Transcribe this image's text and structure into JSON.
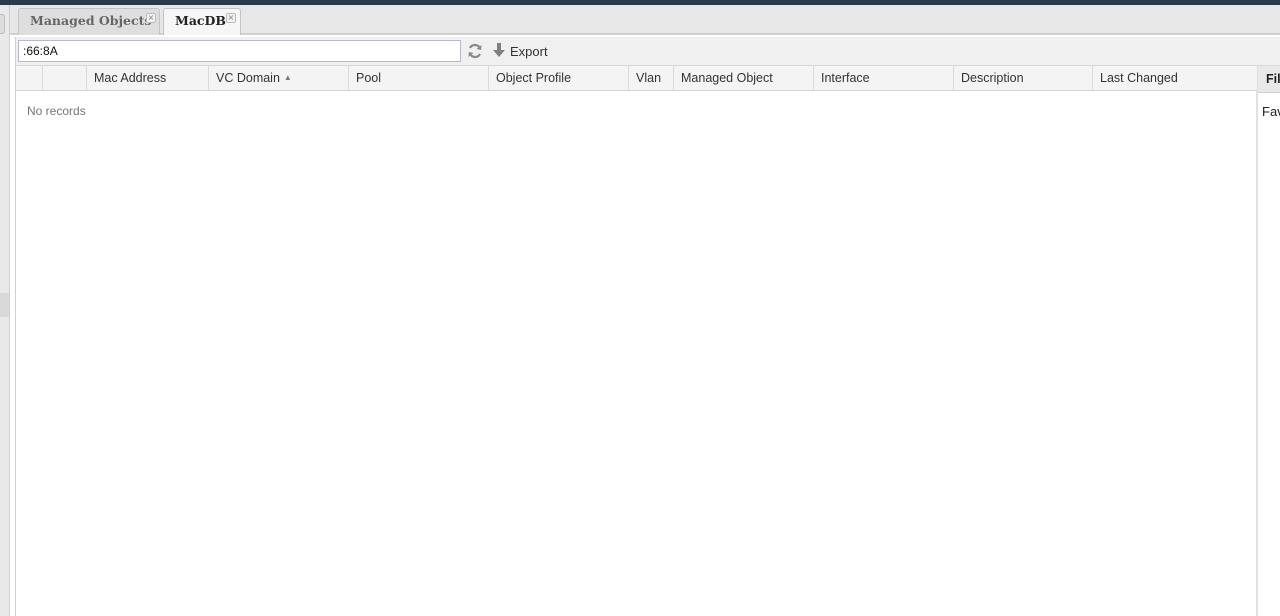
{
  "tabs": [
    {
      "label": "Managed Objects",
      "active": false
    },
    {
      "label": "MacDB",
      "active": true
    }
  ],
  "toolbar": {
    "search_value": ":66:8A",
    "export_label": "Export"
  },
  "grid": {
    "columns": [
      "",
      "",
      "Mac Address",
      "VC Domain",
      "Pool",
      "Object Profile",
      "Vlan",
      "Managed Object",
      "Interface",
      "Description",
      "Last Changed"
    ],
    "sorted_column": "VC Domain",
    "sort_direction": "asc",
    "empty_text": "No records"
  },
  "side_panel": {
    "tab_label": "Filter",
    "favorites_label": "Favorites"
  },
  "colors": {
    "top_strip": "#2d3a4b",
    "tabbar_bg": "#e7e7e7",
    "header_bg": "#f4f4f4"
  }
}
